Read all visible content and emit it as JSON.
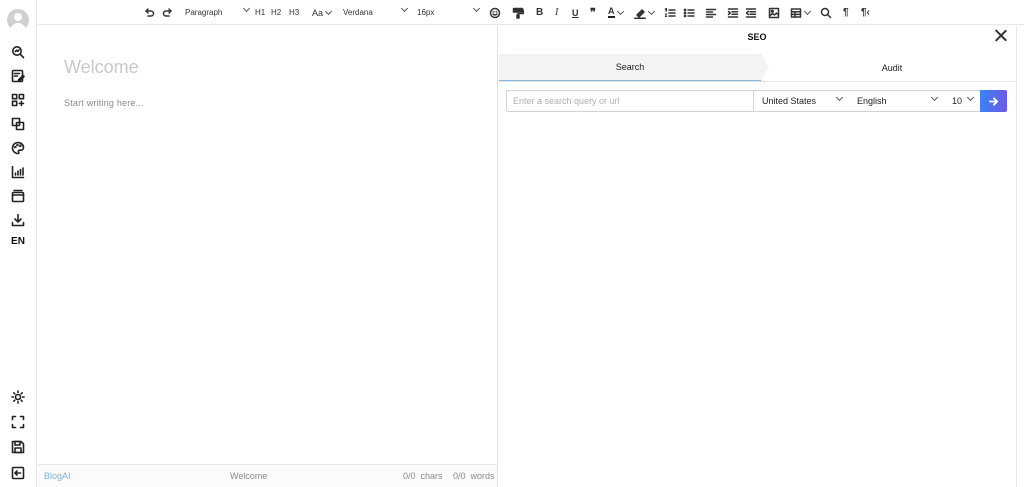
{
  "sidebar": {
    "items": [
      {
        "name": "seo-search-icon"
      },
      {
        "name": "edit-document-icon"
      },
      {
        "name": "add-widget-icon"
      },
      {
        "name": "copy-layers-icon"
      },
      {
        "name": "palette-icon"
      },
      {
        "name": "chart-icon"
      },
      {
        "name": "window-icon"
      },
      {
        "name": "download-icon"
      }
    ],
    "language": "EN",
    "bottom_items": [
      {
        "name": "brightness-icon"
      },
      {
        "name": "fullscreen-icon"
      },
      {
        "name": "save-icon"
      },
      {
        "name": "exit-panel-icon"
      }
    ]
  },
  "toolbar": {
    "block_type": "Paragraph",
    "h1": "H1",
    "h2": "H2",
    "h3": "H3",
    "case_label": "Aa",
    "font_family": "Verdana",
    "font_size": "16px",
    "bold": "B",
    "italic": "I",
    "underline": "U",
    "quote": "❞",
    "text_color_glyph": "A",
    "paragraph_mark": "¶",
    "rtl_mark": "¶‹"
  },
  "editor": {
    "title_placeholder": "Welcome",
    "body_placeholder": "Start writing here..."
  },
  "status": {
    "brand": "BlogAI",
    "doc_name": "Welcome",
    "chars": "0/0  chars",
    "words": "0/0  words"
  },
  "seo": {
    "title": "SEO",
    "tabs": {
      "search": "Search",
      "audit": "Audit"
    },
    "query_placeholder": "Enter a search query or url",
    "country": "United States",
    "language": "English",
    "count": "10"
  }
}
